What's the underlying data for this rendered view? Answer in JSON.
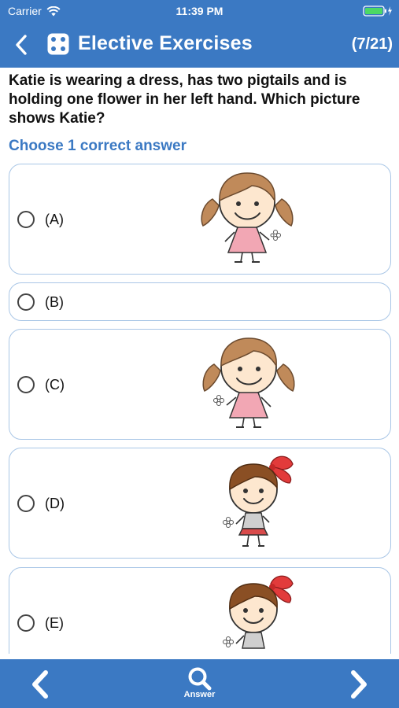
{
  "status_bar": {
    "carrier": "Carrier",
    "time": "11:39 PM",
    "wifi_icon": "wifi-icon",
    "battery_icon": "battery-charging-icon"
  },
  "nav": {
    "back_icon": "chevron-left-icon",
    "app_icon": "dice-icon",
    "title": "Elective Exercises",
    "progress": "(7/21)"
  },
  "question": {
    "text": "Katie is wearing a dress, has two pigtails and is holding one flower in her left hand. Which picture shows Katie?",
    "instruction": "Choose 1 correct answer"
  },
  "options": [
    {
      "label": "(A)",
      "selected": false,
      "image": "girl-pigtails-dress-flower-right"
    },
    {
      "label": "(B)",
      "selected": false,
      "image": ""
    },
    {
      "label": "(C)",
      "selected": false,
      "image": "girl-pigtails-dress-flower-left"
    },
    {
      "label": "(D)",
      "selected": false,
      "image": "girl-bob-bow-flower-left"
    },
    {
      "label": "(E)",
      "selected": false,
      "image": "girl-bob-bow-flower-left"
    }
  ],
  "toolbar": {
    "prev_icon": "chevron-left-icon",
    "answer_icon": "search-icon",
    "answer_label": "Answer",
    "next_icon": "chevron-right-icon"
  },
  "colors": {
    "accent": "#3b79c3",
    "card_border": "#a9c6e6"
  }
}
